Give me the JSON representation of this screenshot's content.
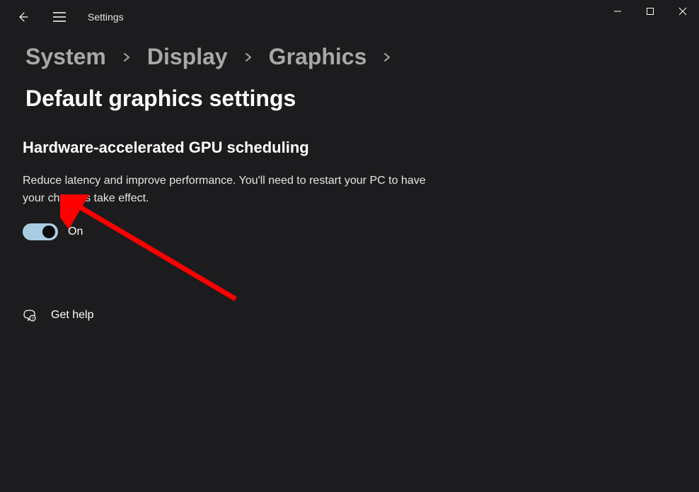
{
  "app_title": "Settings",
  "breadcrumb": {
    "items": [
      {
        "label": "System"
      },
      {
        "label": "Display"
      },
      {
        "label": "Graphics"
      },
      {
        "label": "Default graphics settings"
      }
    ]
  },
  "section": {
    "title": "Hardware-accelerated GPU scheduling",
    "description": "Reduce latency and improve performance. You'll need to restart your PC to have your changes take effect.",
    "toggle_state_label": "On"
  },
  "help": {
    "label": "Get help"
  }
}
